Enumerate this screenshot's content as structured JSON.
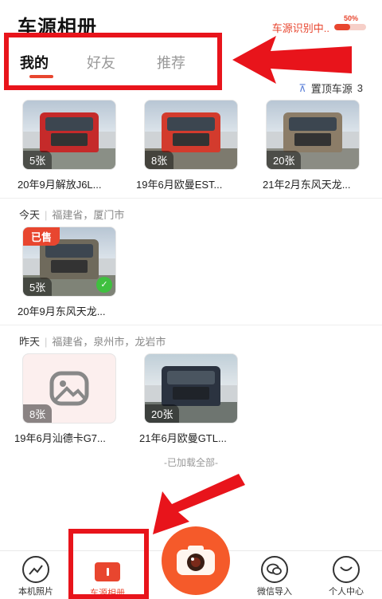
{
  "header": {
    "title": "车源相册",
    "recognition_status": "车源识别中..",
    "progress_label": "50%",
    "progress_fraction": 0.5
  },
  "tabs": [
    {
      "label": "我的",
      "active": true
    },
    {
      "label": "好友",
      "active": false
    },
    {
      "label": "推荐",
      "active": false
    }
  ],
  "pin": {
    "label": "置顶车源",
    "count": "3"
  },
  "pinned_cars": [
    {
      "count": "5张",
      "caption": "20年9月解放J6L..."
    },
    {
      "count": "8张",
      "caption": "19年6月欧曼EST..."
    },
    {
      "count": "20张",
      "caption": "21年2月东风天龙..."
    }
  ],
  "groups": [
    {
      "day": "今天",
      "location": "福建省，厦门市",
      "cars": [
        {
          "count": "5张",
          "caption": "20年9月东风天龙...",
          "badge": "已售"
        }
      ]
    },
    {
      "day": "昨天",
      "location": "福建省，泉州市，龙岩市",
      "cars": [
        {
          "count": "8张",
          "caption": "19年6月汕德卡G7..."
        },
        {
          "count": "20张",
          "caption": "21年6月欧曼GTL..."
        }
      ]
    }
  ],
  "footer_text": "-已加载全部-",
  "bottom_nav": [
    {
      "label": "本机照片",
      "icon": "photo-icon"
    },
    {
      "label": "车源相册",
      "icon": "album-icon",
      "active": true
    },
    {
      "label": "",
      "icon": "camera-icon"
    },
    {
      "label": "微信导入",
      "icon": "wechat-icon"
    },
    {
      "label": "个人中心",
      "icon": "smile-icon"
    }
  ],
  "colors": {
    "accent": "#e8462f",
    "annotation": "#e8141b"
  }
}
